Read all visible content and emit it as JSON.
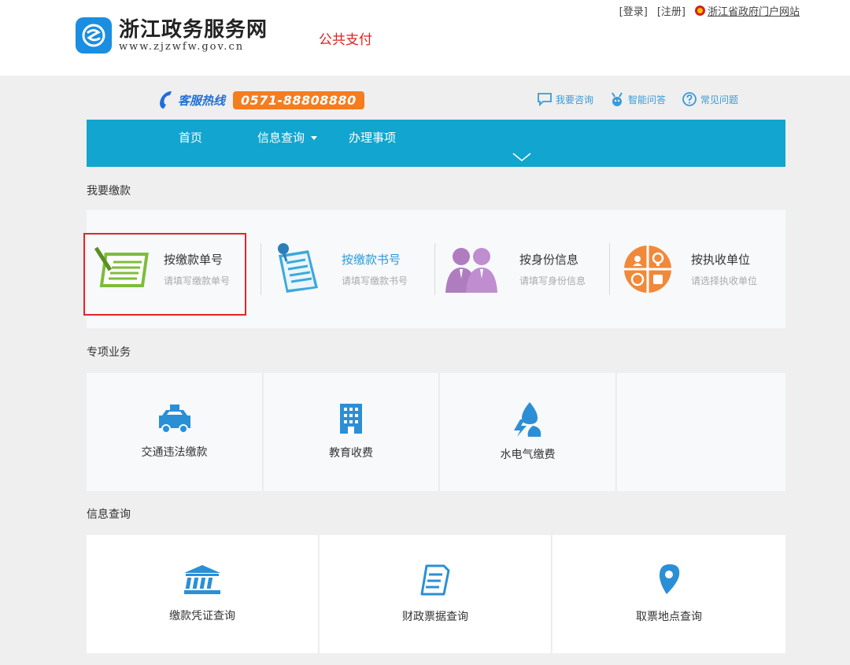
{
  "header": {
    "site_name": "浙江政务服务网",
    "site_url": "www.zjzwfw.gov.cn",
    "page_title": "公共支付",
    "links": {
      "login": "[登录]",
      "register": "[注册]",
      "portal": "浙江省政府门户网站"
    }
  },
  "hotline": {
    "label": "客服热线",
    "number": "0571-88808880"
  },
  "help": {
    "consult": "我要咨询",
    "smart_qa": "智能问答",
    "faq": "常见问题"
  },
  "nav": {
    "home": "首页",
    "info_query": "信息查询",
    "handle": "办理事项"
  },
  "pay_section": {
    "title": "我要缴款",
    "items": [
      {
        "title": "按缴款单号",
        "sub": "请填写缴款单号",
        "icon": "notepad-icon"
      },
      {
        "title": "按缴款书号",
        "sub": "请填写缴款书号",
        "icon": "pinned-document-icon"
      },
      {
        "title": "按身份信息",
        "sub": "请填写身份信息",
        "icon": "people-icon"
      },
      {
        "title": "按执收单位",
        "sub": "请选择执收单位",
        "icon": "unit-circle-icon"
      }
    ]
  },
  "special_section": {
    "title": "专项业务",
    "items": [
      {
        "label": "交通违法缴款",
        "icon": "taxi-icon"
      },
      {
        "label": "教育收费",
        "icon": "building-icon"
      },
      {
        "label": "水电气缴费",
        "icon": "utility-icon"
      }
    ]
  },
  "info_section": {
    "title": "信息查询",
    "items": [
      {
        "label": "缴款凭证查询",
        "icon": "bank-icon"
      },
      {
        "label": "财政票据查询",
        "icon": "receipt-icon"
      },
      {
        "label": "取票地点查询",
        "icon": "location-pin-icon"
      }
    ]
  },
  "colors": {
    "accent": "#11a5cf",
    "hotline": "#f57c1f",
    "highlight": "#e0262a",
    "link": "#3a9ad9"
  }
}
